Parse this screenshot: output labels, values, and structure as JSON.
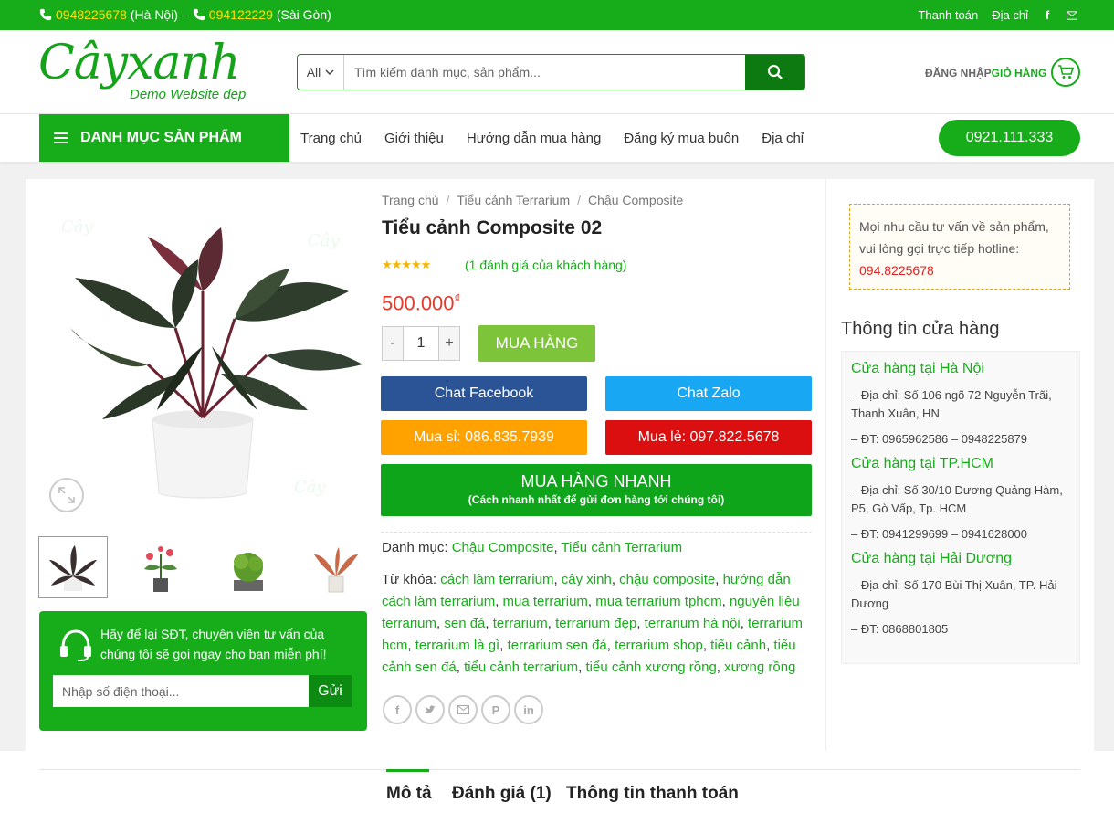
{
  "topbar": {
    "phone1": "0948225678",
    "city1": "(Hà Nội)",
    "dash": "–",
    "phone2": "094122229",
    "city2": "(Sài Gòn)",
    "links": [
      "Thanh toán",
      "Địa chỉ"
    ],
    "social": [
      "facebook-icon",
      "mail-icon"
    ]
  },
  "header": {
    "logo_text": "Câyxanh",
    "logo_tagline": "Demo Website đẹp",
    "search_category": "All",
    "search_placeholder": "Tìm kiếm danh mục, sản phẩm...",
    "login": "ĐĂNG NHẬP",
    "cart": "GIỎ HÀNG"
  },
  "nav": {
    "category_menu": "DANH MỤC SẢN PHẨM",
    "links": [
      "Trang chủ",
      "Giới thiệu",
      "Hướng dẫn mua hàng",
      "Đăng ký mua buôn",
      "Địa chỉ"
    ],
    "hotline": "0921.111.333"
  },
  "product": {
    "breadcrumb": [
      "Trang chủ",
      "Tiểu cảnh Terrarium",
      "Chậu Composite"
    ],
    "title": "Tiểu cảnh Composite 02",
    "rating": 5,
    "reviews": "(1 đánh giá của khách hàng)",
    "price": "500.000",
    "currency": "₫",
    "quantity": "1",
    "buy_label": "MUA HÀNG",
    "chat_facebook": "Chat Facebook",
    "chat_zalo": "Chat Zalo",
    "wholesale": "Mua sỉ: 086.835.7939",
    "retail": "Mua lẻ: 097.822.5678",
    "fast_buy": "MUA HÀNG NHANH",
    "fast_buy_sub": "(Cách nhanh nhất để gửi đơn hàng tới chúng tôi)",
    "category_label": "Danh mục:",
    "categories": [
      "Chậu Composite",
      "Tiểu cảnh Terrarium"
    ],
    "tags_label": "Từ khóa:",
    "tags": [
      "cách làm terrarium",
      "cây xinh",
      "chậu composite",
      "hướng dẫn cách làm terrarium",
      "mua terrarium",
      "mua terrarium tphcm",
      "nguyên liệu terrarium",
      "sen đá",
      "terrarium",
      "terrarium đẹp",
      "terrarium hà nội",
      "terrarium hcm",
      "terrarium là gì",
      "terrarium sen đá",
      "terrarium shop",
      "tiểu cảnh",
      "tiểu cảnh sen đá",
      "tiểu cảnh terrarium",
      "tiểu cảnh xương rồng",
      "xương rồng"
    ],
    "share_icons": [
      "facebook-icon",
      "twitter-icon",
      "email-icon",
      "pinterest-icon",
      "linkedin-icon"
    ]
  },
  "consult": {
    "text": "Hãy để lại SĐT, chuyên viên tư vấn của chúng tôi sẽ gọi ngay cho bạn miễn phí!",
    "placeholder": "Nhập số điện thoại...",
    "send": "Gửi"
  },
  "sidebar": {
    "notice": "Mọi nhu cầu tư vấn về sản phẩm, vui lòng gọi trực tiếp hotline:",
    "notice_phone": "094.8225678",
    "title": "Thông tin cửa hàng",
    "stores": [
      {
        "name": "Cửa hàng tại Hà Nội",
        "address": "– Địa chỉ: Số 106 ngõ 72 Nguyễn Trãi, Thanh Xuân, HN",
        "phone": "– ĐT: 0965962586 – 0948225879"
      },
      {
        "name": "Cửa hàng tại TP.HCM",
        "address": "– Địa chỉ: Số 30/10 Dương Quảng Hàm, P5, Gò Vấp, Tp. HCM",
        "phone": "– ĐT: 0941299699 – 0941628000"
      },
      {
        "name": "Cửa hàng tại Hải Dương",
        "address": "– Địa chỉ: Số 170 Bùi Thị Xuân, TP. Hải Dương",
        "phone": "– ĐT: 0868801805"
      }
    ]
  },
  "tabs": [
    "Mô tả",
    "Đánh giá (1)",
    "Thông tin thanh toán"
  ],
  "colors": {
    "brand": "#17ad1a",
    "price": "#e33b2e",
    "facebook": "#2a5496",
    "zalo": "#18a7f2",
    "wholesale": "#ffa200",
    "retail": "#db0f0f"
  }
}
